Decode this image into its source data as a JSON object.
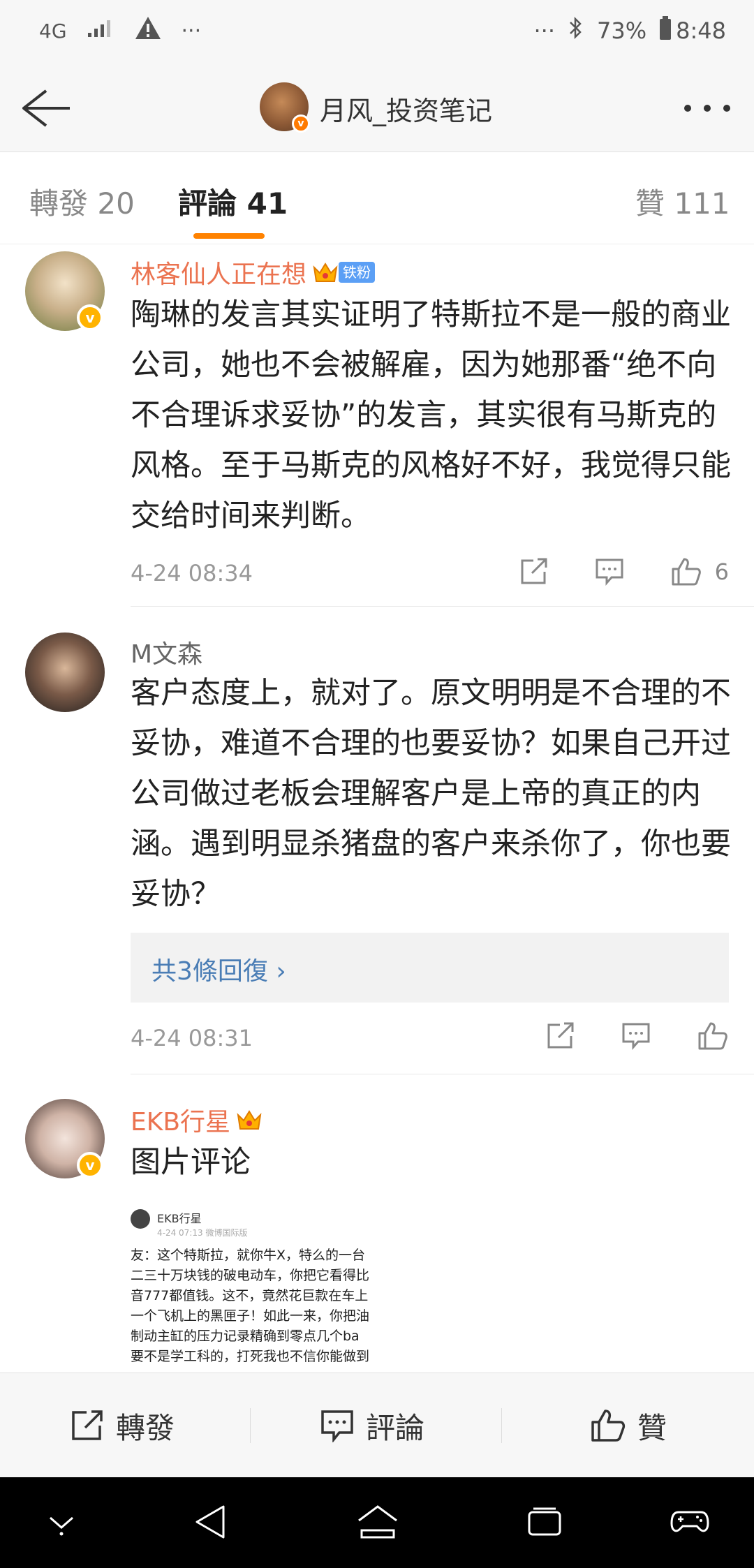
{
  "status_bar": {
    "network": "4G",
    "more_left": "···",
    "more_right": "···",
    "battery": "73%",
    "time": "8:48"
  },
  "header": {
    "title": "月风_投资笔记"
  },
  "tabs": [
    {
      "label": "轉發 20"
    },
    {
      "label": "評論 41"
    },
    {
      "label": "贊 111"
    }
  ],
  "comments": [
    {
      "name": "林客仙人正在想",
      "badge": "铁粉",
      "text": "陶琳的发言其实证明了特斯拉不是一般的商业公司，她也不会被解雇，因为她那番“绝不向不合理诉求妥协”的发言，其实很有马斯克的风格。至于马斯克的风格好不好，我觉得只能交给时间来判断。",
      "time": "4-24 08:34",
      "likes": "6"
    },
    {
      "name": "M文森",
      "text": "客户态度上，就对了。原文明明是不合理的不妥协，难道不合理的也要妥协？如果自己开过公司做过老板会理解客户是上帝的真正的内涵。遇到明显杀猪盘的客户来杀你了，你也要妥协？",
      "replies": "共3條回復 ›",
      "time": "4-24 08:31"
    },
    {
      "name": "EKB行星",
      "text": "图片评论",
      "image": {
        "name": "EKB行星",
        "meta": "4-24 07:13  微博国际版",
        "lines": [
          "友：这个特斯拉，就你牛X，特么的一台",
          "二三十万块钱的破电动车，你把它看得比",
          "音777都值钱。这不，竟然花巨款在车上",
          "一个飞机上的黑匣子！如此一来，你把油",
          "制动主缸的压力记录精确到零点几个ba",
          "要不是学工科的，打死我也不信你能做到"
        ]
      }
    }
  ],
  "bottom_bar": {
    "repost": "轉發",
    "comment": "評論",
    "like": "贊"
  },
  "colors": {
    "accent": "#ff8200",
    "name_orange": "#eb7350",
    "link_blue": "#4a7db5"
  }
}
